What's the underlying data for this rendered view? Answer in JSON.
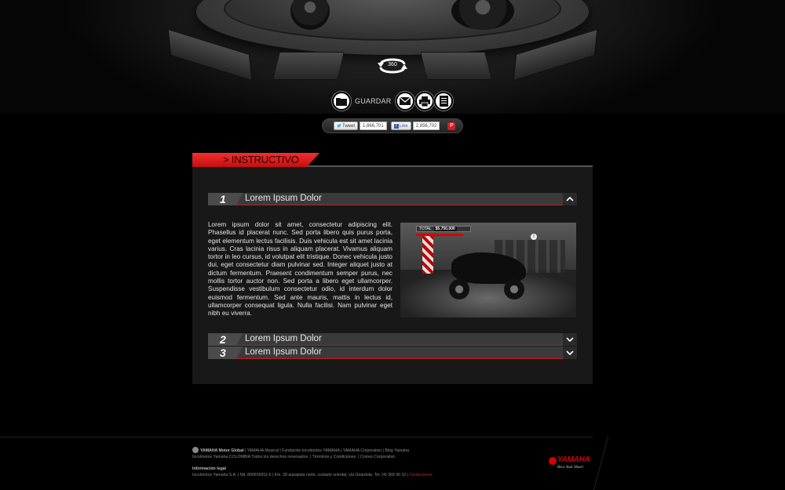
{
  "viewer": {
    "rotate_label": "360"
  },
  "toolbar": {
    "save_label": "GUARDAR"
  },
  "social": {
    "tweet_label": "Tweet",
    "tweet_count": "1,866,701",
    "like_label": "Like",
    "like_count": "2,856,702",
    "pin_label": "P"
  },
  "section": {
    "title": "> INSTRUCTIVO"
  },
  "accordion": [
    {
      "number": "1",
      "title": "Lorem Ipsum Dolor",
      "expanded": true
    },
    {
      "number": "2",
      "title": "Lorem Ipsum Dolor",
      "expanded": false
    },
    {
      "number": "3",
      "title": "Lorem Ipsum Dolor",
      "expanded": false
    }
  ],
  "content": {
    "body": "Lorem ipsum dolor sit amet, consectetur adipiscing elit. Phasellus id placerat nunc. Sed porta libero quis purus porta, eget elementum lectus facilisis. Duis vehicula est sit amet lacinia varius. Cras lacinia risus in aliquam placerat. Vivamus aliquam tortor in leo cursus, id volutpat elit tristique. Donec vehicula justo dui, eget consectetur diam pulvinar sed. Integer aliquet justo at dictum fermentum. Praesent condimentum semper purus, nec mollis tortor auctor non. Sed porta a libero eget ullamcorper. Suspendisse vestibulum consectetur odio, id interdum dolor euismod fermentum. Sed ante mauris, mattis in lectus id, ullamcorper consequat ligula. Nulla facilisi. Nam pulvinar eget nibh eu viverra.",
    "preview_total_label": "TOTAL",
    "preview_total_value": "$5,750,000"
  },
  "footer": {
    "brand": "YAMAHA Motor Global",
    "links": " | YAMAHA Musical | Fundación Incolmotos YAMAHA | YAMAHA Corporativo | Blog Yamaha",
    "rights": "Incolmotos Yamaha COLOMBIA Todos los derechos reservados. | Términos y Condiciones. | Correo Corporativo",
    "legal_title": "Información legal",
    "legal_text": "Incolmotos Yamaha S.A. | Nit. 890916911-6 | Km. 28 autopista norte, costado oriental, vía Girardota. Tel: (4) 369 90 10 | ",
    "contact_label": "Contáctenos"
  },
  "logo": {
    "word": "YAMAHA",
    "tagline": "Revs Your Heart"
  },
  "colors": {
    "accent_red": "#d8141b",
    "background": "#000000",
    "panel": "#181818"
  }
}
